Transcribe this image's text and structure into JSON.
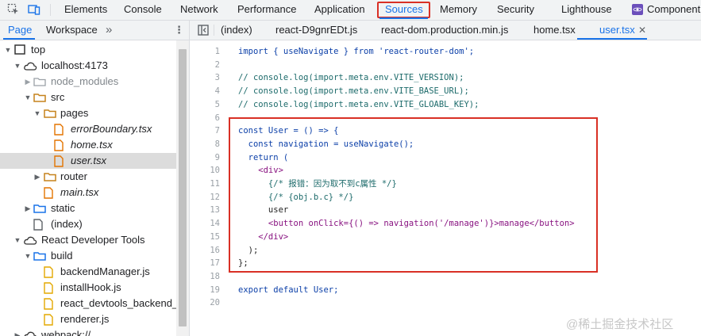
{
  "toolbar": {
    "tabs": [
      "Elements",
      "Console",
      "Network",
      "Performance",
      "Application",
      "Sources",
      "Memory",
      "Security",
      "Lighthouse",
      "Component"
    ],
    "active_tab": "Sources"
  },
  "left_panel": {
    "tabs": [
      "Page",
      "Workspace"
    ],
    "more": "»"
  },
  "tree": [
    {
      "label": "top",
      "icon": "frame-icon"
    },
    {
      "label": "localhost:4173",
      "icon": "cloud-icon"
    },
    {
      "label": "node_modules",
      "icon": "folder-icon"
    },
    {
      "label": "src",
      "icon": "folder-icon"
    },
    {
      "label": "pages",
      "icon": "folder-icon"
    },
    {
      "label": "errorBoundary.tsx",
      "icon": "file-icon"
    },
    {
      "label": "home.tsx",
      "icon": "file-icon"
    },
    {
      "label": "user.tsx",
      "icon": "file-icon"
    },
    {
      "label": "router",
      "icon": "folder-icon"
    },
    {
      "label": "main.tsx",
      "icon": "file-icon"
    },
    {
      "label": "static",
      "icon": "folder-icon"
    },
    {
      "label": "(index)",
      "icon": "file-icon"
    },
    {
      "label": "React Developer Tools",
      "icon": "cloud-icon"
    },
    {
      "label": "build",
      "icon": "folder-icon"
    },
    {
      "label": "backendManager.js",
      "icon": "file-icon"
    },
    {
      "label": "installHook.js",
      "icon": "file-icon"
    },
    {
      "label": "react_devtools_backend_c",
      "icon": "file-icon"
    },
    {
      "label": "renderer.js",
      "icon": "file-icon"
    },
    {
      "label": "webpack://",
      "icon": "cloud-icon"
    }
  ],
  "editor": {
    "tabs": [
      "(index)",
      "react-D9gnrEDt.js",
      "react-dom.production.min.js",
      "home.tsx",
      "user.tsx"
    ],
    "active_tab": "user.tsx",
    "line_numbers": [
      "1",
      "2",
      "3",
      "4",
      "5",
      "6",
      "7",
      "8",
      "9",
      "10",
      "11",
      "12",
      "13",
      "14",
      "15",
      "16",
      "17",
      "18",
      "19",
      "20"
    ],
    "lines": [
      "import { useNavigate } from 'react-router-dom';",
      "",
      "// console.log(import.meta.env.VITE_VERSION);",
      "// console.log(import.meta.env.VITE_BASE_URL);",
      "// console.log(import.meta.env.VITE_GLOABL_KEY);",
      "",
      "const User = () => {",
      "  const navigation = useNavigate();",
      "  return (",
      "    <div>",
      "      {/* 报错：因为取不到c属性 */}",
      "      {/* {obj.b.c} */}",
      "      user",
      "      <button onClick={() => navigation('/manage')}>manage</button>",
      "    </div>",
      "  );",
      "};",
      "",
      "export default User;",
      ""
    ]
  },
  "watermark": "@稀土掘金技术社区",
  "colors": {
    "accent": "#1a73e8",
    "highlight": "#d93025"
  }
}
